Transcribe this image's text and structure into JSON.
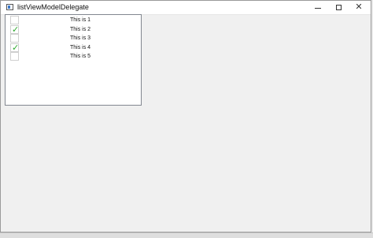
{
  "window": {
    "title": "listViewModelDelegate"
  },
  "list": {
    "items": [
      {
        "label": "This is 1",
        "checked": false
      },
      {
        "label": "This is 2",
        "checked": true
      },
      {
        "label": "This is 3",
        "checked": false
      },
      {
        "label": "This is 4",
        "checked": true
      },
      {
        "label": "This is 5",
        "checked": false
      }
    ]
  },
  "icons": {
    "check": "✓",
    "close": "✕"
  },
  "colors": {
    "check": "#2eaa2e",
    "window_bg": "#f0f0f0"
  }
}
